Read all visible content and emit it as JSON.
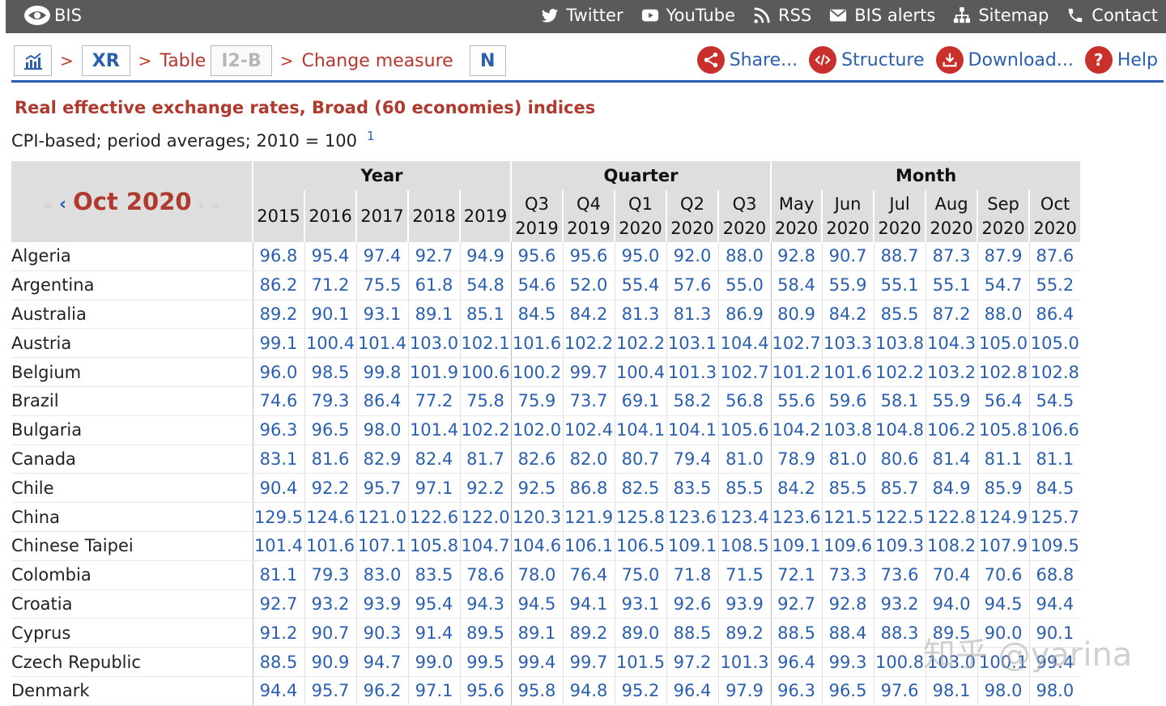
{
  "topbar": {
    "brand": "BIS",
    "links": [
      {
        "label": "Twitter",
        "icon": "twitter-icon"
      },
      {
        "label": "YouTube",
        "icon": "youtube-icon"
      },
      {
        "label": "RSS",
        "icon": "rss-icon"
      },
      {
        "label": "BIS alerts",
        "icon": "envelope-icon"
      },
      {
        "label": "Sitemap",
        "icon": "sitemap-icon"
      },
      {
        "label": "Contact",
        "icon": "phone-icon"
      }
    ]
  },
  "breadcrumb": {
    "dataset": "XR",
    "table_label": "Table",
    "table_code": "I2-B",
    "measure_label": "Change measure",
    "measure_code": "N",
    "separator": ">"
  },
  "actions": [
    {
      "label": "Share...",
      "icon": "share-icon"
    },
    {
      "label": "Structure",
      "icon": "code-icon"
    },
    {
      "label": "Download...",
      "icon": "download-icon"
    },
    {
      "label": "Help",
      "icon": "help-icon"
    }
  ],
  "title": "Real effective exchange rates, Broad (60 economies) indices",
  "subtitle": "CPI-based; period averages; 2010 = 100",
  "subtitle_note": "1",
  "period": {
    "current": "Oct 2020",
    "first": "«",
    "prev": "‹",
    "next": "›",
    "last": "»"
  },
  "groups": [
    {
      "label": "Year",
      "span": 5
    },
    {
      "label": "Quarter",
      "span": 5
    },
    {
      "label": "Month",
      "span": 6
    }
  ],
  "columns": [
    [
      "2015"
    ],
    [
      "2016"
    ],
    [
      "2017"
    ],
    [
      "2018"
    ],
    [
      "2019"
    ],
    [
      "Q3",
      "2019"
    ],
    [
      "Q4",
      "2019"
    ],
    [
      "Q1",
      "2020"
    ],
    [
      "Q2",
      "2020"
    ],
    [
      "Q3",
      "2020"
    ],
    [
      "May",
      "2020"
    ],
    [
      "Jun",
      "2020"
    ],
    [
      "Jul",
      "2020"
    ],
    [
      "Aug",
      "2020"
    ],
    [
      "Sep",
      "2020"
    ],
    [
      "Oct",
      "2020"
    ]
  ],
  "rows": [
    {
      "country": "Algeria",
      "values": [
        "96.8",
        "95.4",
        "97.4",
        "92.7",
        "94.9",
        "95.6",
        "95.6",
        "95.0",
        "92.0",
        "88.0",
        "92.8",
        "90.7",
        "88.7",
        "87.3",
        "87.9",
        "87.6"
      ]
    },
    {
      "country": "Argentina",
      "values": [
        "86.2",
        "71.2",
        "75.5",
        "61.8",
        "54.8",
        "54.6",
        "52.0",
        "55.4",
        "57.6",
        "55.0",
        "58.4",
        "55.9",
        "55.1",
        "55.1",
        "54.7",
        "55.2"
      ]
    },
    {
      "country": "Australia",
      "values": [
        "89.2",
        "90.1",
        "93.1",
        "89.1",
        "85.1",
        "84.5",
        "84.2",
        "81.3",
        "81.3",
        "86.9",
        "80.9",
        "84.2",
        "85.5",
        "87.2",
        "88.0",
        "86.4"
      ]
    },
    {
      "country": "Austria",
      "values": [
        "99.1",
        "100.4",
        "101.4",
        "103.0",
        "102.1",
        "101.6",
        "102.2",
        "102.2",
        "103.1",
        "104.4",
        "102.7",
        "103.3",
        "103.8",
        "104.3",
        "105.0",
        "105.0"
      ]
    },
    {
      "country": "Belgium",
      "values": [
        "96.0",
        "98.5",
        "99.8",
        "101.9",
        "100.6",
        "100.2",
        "99.7",
        "100.4",
        "101.3",
        "102.7",
        "101.2",
        "101.6",
        "102.2",
        "103.2",
        "102.8",
        "102.8"
      ]
    },
    {
      "country": "Brazil",
      "values": [
        "74.6",
        "79.3",
        "86.4",
        "77.2",
        "75.8",
        "75.9",
        "73.7",
        "69.1",
        "58.2",
        "56.8",
        "55.6",
        "59.6",
        "58.1",
        "55.9",
        "56.4",
        "54.5"
      ]
    },
    {
      "country": "Bulgaria",
      "values": [
        "96.3",
        "96.5",
        "98.0",
        "101.4",
        "102.2",
        "102.0",
        "102.4",
        "104.1",
        "104.1",
        "105.6",
        "104.2",
        "103.8",
        "104.8",
        "106.2",
        "105.8",
        "106.6"
      ]
    },
    {
      "country": "Canada",
      "values": [
        "83.1",
        "81.6",
        "82.9",
        "82.4",
        "81.7",
        "82.6",
        "82.0",
        "80.7",
        "79.4",
        "81.0",
        "78.9",
        "81.0",
        "80.6",
        "81.4",
        "81.1",
        "81.1"
      ]
    },
    {
      "country": "Chile",
      "values": [
        "90.4",
        "92.2",
        "95.7",
        "97.1",
        "92.2",
        "92.5",
        "86.8",
        "82.5",
        "83.5",
        "85.5",
        "84.2",
        "85.5",
        "85.7",
        "84.9",
        "85.9",
        "84.5"
      ]
    },
    {
      "country": "China",
      "values": [
        "129.5",
        "124.6",
        "121.0",
        "122.6",
        "122.0",
        "120.3",
        "121.9",
        "125.8",
        "123.6",
        "123.4",
        "123.6",
        "121.5",
        "122.5",
        "122.8",
        "124.9",
        "125.7"
      ]
    },
    {
      "country": "Chinese Taipei",
      "values": [
        "101.4",
        "101.6",
        "107.1",
        "105.8",
        "104.7",
        "104.6",
        "106.1",
        "106.5",
        "109.1",
        "108.5",
        "109.1",
        "109.6",
        "109.3",
        "108.2",
        "107.9",
        "109.5"
      ]
    },
    {
      "country": "Colombia",
      "values": [
        "81.1",
        "79.3",
        "83.0",
        "83.5",
        "78.6",
        "78.0",
        "76.4",
        "75.0",
        "71.8",
        "71.5",
        "72.1",
        "73.3",
        "73.6",
        "70.4",
        "70.6",
        "68.8"
      ]
    },
    {
      "country": "Croatia",
      "values": [
        "92.7",
        "93.2",
        "93.9",
        "95.4",
        "94.3",
        "94.5",
        "94.1",
        "93.1",
        "92.6",
        "93.9",
        "92.7",
        "92.8",
        "93.2",
        "94.0",
        "94.5",
        "94.4"
      ]
    },
    {
      "country": "Cyprus",
      "values": [
        "91.2",
        "90.7",
        "90.3",
        "91.4",
        "89.5",
        "89.1",
        "89.2",
        "89.0",
        "88.5",
        "89.2",
        "88.5",
        "88.4",
        "88.3",
        "89.5",
        "90.0",
        "90.1"
      ]
    },
    {
      "country": "Czech Republic",
      "values": [
        "88.5",
        "90.9",
        "94.7",
        "99.0",
        "99.5",
        "99.4",
        "99.7",
        "101.5",
        "97.2",
        "101.3",
        "96.4",
        "99.3",
        "100.8",
        "103.0",
        "100.1",
        "99.4"
      ]
    },
    {
      "country": "Denmark",
      "values": [
        "94.4",
        "95.7",
        "96.2",
        "97.1",
        "95.6",
        "95.8",
        "94.8",
        "95.2",
        "96.4",
        "97.9",
        "96.3",
        "96.5",
        "97.6",
        "98.1",
        "98.0",
        "98.0"
      ]
    }
  ],
  "watermark": "知乎 @yarina"
}
